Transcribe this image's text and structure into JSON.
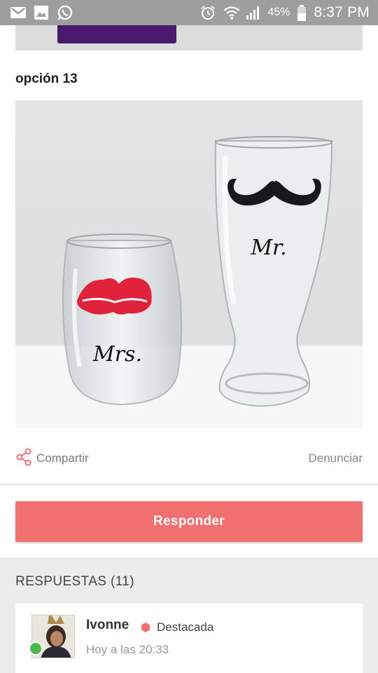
{
  "status_bar": {
    "battery": "45%",
    "time": "8:37 PM",
    "icons": [
      "gmail-icon",
      "gallery-icon",
      "whatsapp-icon",
      "alarm-icon",
      "wifi-icon",
      "signal-icon",
      "battery-icon"
    ]
  },
  "post": {
    "option_title": "opción 13",
    "photo": {
      "left_glass_text": "Mrs.",
      "right_glass_text": "Mr."
    },
    "share_label": "Compartir",
    "report_label": "Denunciar",
    "reply_label": "Responder"
  },
  "answers": {
    "title": "RESPUESTAS (11)",
    "items": [
      {
        "user": "Ivonne",
        "badge": "Destacada",
        "time": "Hoy a las 20:33"
      }
    ]
  },
  "colors": {
    "accent": "#f07070",
    "status_bar": "#9e9e9e",
    "online": "#4cb84c"
  }
}
